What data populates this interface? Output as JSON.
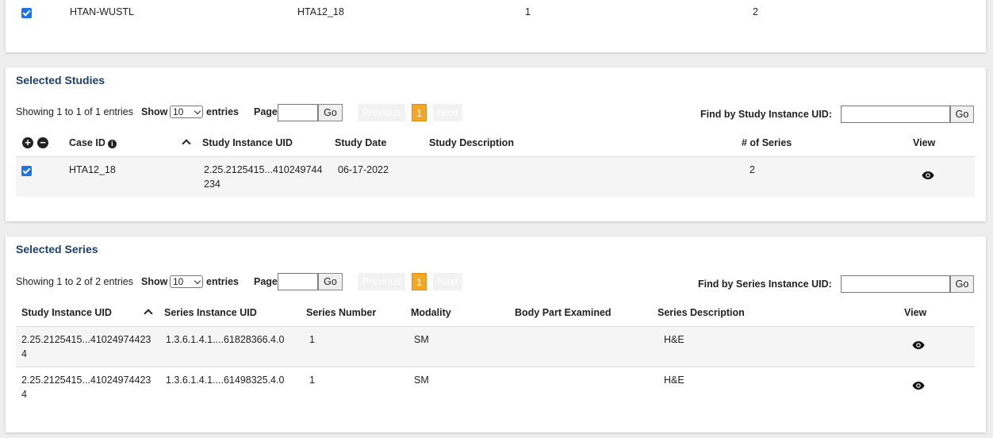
{
  "top_row": {
    "collection": "HTAN-WUSTL",
    "case_id": "HTA12_18",
    "num_studies": "1",
    "num_series": "2"
  },
  "studies": {
    "title": "Selected Studies",
    "showing": "Showing 1 to 1 of 1 entries",
    "show_label": "Show",
    "page_size": "10",
    "entries_label": "entries",
    "page_label": "Page",
    "go_label": "Go",
    "previous_label": "Previous",
    "current_page": "1",
    "next_label": "Next",
    "find_label": "Find by Study Instance UID:",
    "columns": {
      "case_id": "Case ID",
      "study_uid": "Study Instance UID",
      "study_date": "Study Date",
      "study_description": "Study Description",
      "num_series": "# of Series",
      "view": "View"
    },
    "rows": [
      {
        "case_id": "HTA12_18",
        "study_uid_line1": "2.25.2125415...410249744",
        "study_uid_line2": "234",
        "study_date": "06-17-2022",
        "study_description": "",
        "num_series": "2"
      }
    ]
  },
  "series": {
    "title": "Selected Series",
    "showing": "Showing 1 to 2 of 2 entries",
    "show_label": "Show",
    "page_size": "10",
    "entries_label": "entries",
    "page_label": "Page",
    "go_label": "Go",
    "previous_label": "Previous",
    "current_page": "1",
    "next_label": "Next",
    "find_label": "Find by Series Instance UID:",
    "columns": {
      "study_uid": "Study Instance UID",
      "series_uid": "Series Instance UID",
      "series_number": "Series Number",
      "modality": "Modality",
      "body_part": "Body Part Examined",
      "series_description": "Series Description",
      "view": "View"
    },
    "rows": [
      {
        "study_uid_line1": "2.25.2125415...41024974423",
        "study_uid_line2": "4",
        "series_uid": "1.3.6.1.4.1....61828366.4.0",
        "series_number": "1",
        "modality": "SM",
        "body_part": "",
        "series_description": "H&E"
      },
      {
        "study_uid_line1": "2.25.2125415...41024974423",
        "study_uid_line2": "4",
        "series_uid": "1.3.6.1.4.1....61498325.4.0",
        "series_number": "1",
        "modality": "SM",
        "body_part": "",
        "series_description": "H&E"
      }
    ]
  },
  "icons": {
    "expand_all": "plus-circle-icon",
    "collapse_all": "minus-circle-icon",
    "info": "info-icon",
    "sort": "sort-up-icon",
    "view": "eye-icon"
  },
  "colors": {
    "section_title": "#1d3f6e",
    "current_page": "#f5a623",
    "checkbox": "#1a73e8"
  }
}
